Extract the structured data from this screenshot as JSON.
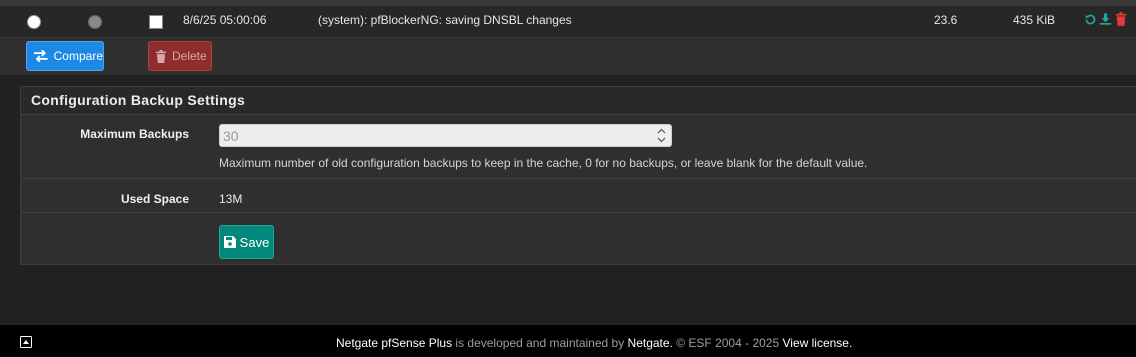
{
  "history_row": {
    "date": "8/6/25 05:00:06",
    "description": "(system): pfBlockerNG: saving DNSBL changes",
    "version": "23.6",
    "size": "435 KiB",
    "actions": [
      "restore-icon",
      "download-icon",
      "trash-icon"
    ]
  },
  "toolbar": {
    "compare_label": "Compare",
    "delete_label": "Delete"
  },
  "settings": {
    "title": "Configuration Backup Settings",
    "max_backups": {
      "label": "Maximum Backups",
      "value": "30",
      "help": "Maximum number of old configuration backups to keep in the cache, 0 for no backups, or leave blank for the default value."
    },
    "used_space": {
      "label": "Used Space",
      "value": "13M"
    },
    "save_label": "Save"
  },
  "footer": {
    "brand": "Netgate pfSense Plus",
    "middle": " is developed and maintained by ",
    "company": "Netgate.",
    "copyright": " © ESF 2004 - 2025 ",
    "license": "View license."
  },
  "colors": {
    "compare": "#1e88e5",
    "delete": "#8d2d2d",
    "save": "#00897b",
    "action_green": "#26a69a",
    "action_red": "#e53935"
  }
}
